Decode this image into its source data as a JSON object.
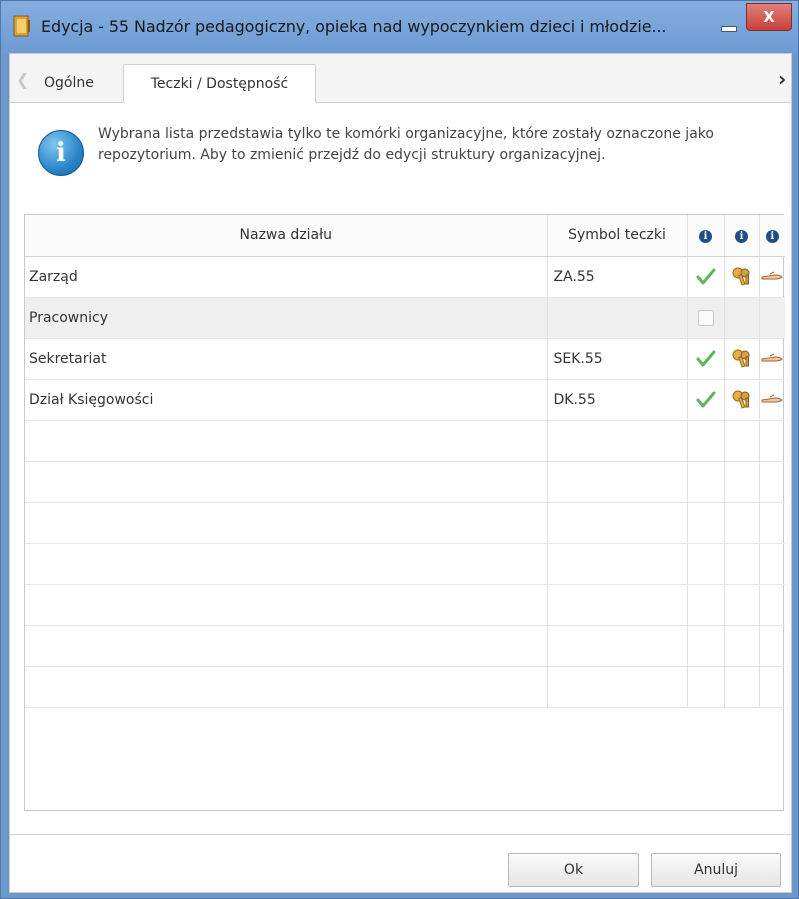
{
  "window": {
    "title": "Edycja - 55 Nadzór pedagogiczny, opieka nad wypoczynkiem dzieci i młodzie...",
    "close_label": "X"
  },
  "tabs": [
    {
      "label": "Ogólne",
      "active": false
    },
    {
      "label": "Teczki / Dostępność",
      "active": true
    }
  ],
  "info": {
    "text": "Wybrana lista przedstawia tylko te komórki organizacyjne, które zostały oznaczone jako repozytorium. Aby to zmienić przejdź do edycji struktury organizacyjnej."
  },
  "grid": {
    "columns": {
      "name": "Nazwa działu",
      "symbol": "Symbol teczki"
    },
    "rows": [
      {
        "name": "Zarząd",
        "symbol": "ZA.55",
        "checked": true,
        "key": true,
        "hand": true
      },
      {
        "name": "Pracownicy",
        "symbol": "",
        "checked": false,
        "key": false,
        "hand": false
      },
      {
        "name": "Sekretariat",
        "symbol": "SEK.55",
        "checked": true,
        "key": true,
        "hand": true
      },
      {
        "name": "Dział Księgowości",
        "symbol": "DK.55",
        "checked": true,
        "key": true,
        "hand": true
      }
    ]
  },
  "buttons": {
    "ok": "Ok",
    "cancel": "Anuluj"
  },
  "colors": {
    "titlebar": "#6d9bd3",
    "close": "#c7403a",
    "check": "#5cb85c"
  }
}
